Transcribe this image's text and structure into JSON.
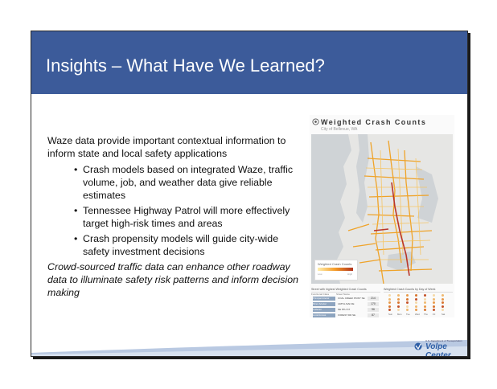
{
  "slide": {
    "title": "Insights – What Have We Learned?",
    "intro": "Waze data provide important contextual information to inform state and local safety applications",
    "bullets": [
      "Crash models based on integrated Waze, traffic volume, job, and weather data give reliable estimates",
      "Tennessee Highway Patrol will more effectively target high-risk times and areas",
      "Crash propensity models will guide city-wide safety investment decisions"
    ],
    "conclusion": "Crowd-sourced traffic data can enhance other roadway data to illuminate safety risk patterns and inform decision making"
  },
  "dashboard": {
    "title": "Weighted Crash Counts",
    "subtitle": "City of Bellevue, WA",
    "legend": {
      "label": "Weighted Crash Counts",
      "low": "Low",
      "high": "High"
    },
    "table": {
      "title": "Street with highest Weighted Crash Counts",
      "columns": [
        "Functional Class",
        "Street Name"
      ],
      "rows": [
        {
          "class": "Principal Arterial",
          "street": "COAL CREEK PKWY SE",
          "value": "214"
        },
        {
          "class": "Minor Arterial",
          "street": "148TH AVE NE",
          "value": "170"
        },
        {
          "class": "Collector",
          "street": "NE 8TH ST",
          "value": "96"
        },
        {
          "class": "Local Access",
          "street": "FOREST DR SE",
          "value": "87"
        }
      ]
    },
    "day_chart": {
      "title": "Weighted Crash Counts by Day of Week",
      "days": [
        "Sun",
        "Mon",
        "Tue",
        "Wed",
        "Thu",
        "Fri",
        "Sat"
      ]
    }
  },
  "logo": {
    "agency": "U.S. Department of Transportation",
    "name": "Volpe Center"
  },
  "colors": {
    "title_bar": "#3c5b9a",
    "footer": "#b9c9e2",
    "map_roads": "#f0a020",
    "logo": "#2d5ea6"
  }
}
